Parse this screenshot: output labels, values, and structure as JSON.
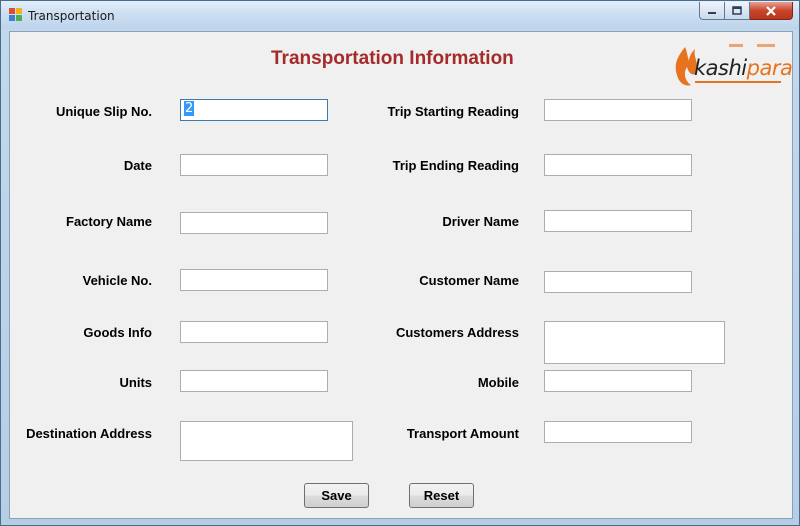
{
  "window": {
    "title": "Transportation",
    "colors": {
      "heading": "#a52a2a",
      "logo_accent": "#e8731e",
      "close": "#c9462c"
    }
  },
  "form": {
    "heading": "Transportation Information",
    "logo": {
      "prefix": "kashi",
      "accent": "para"
    },
    "left_fields": [
      {
        "label": "Unique Slip No.",
        "value": "2"
      },
      {
        "label": "Date",
        "value": ""
      },
      {
        "label": "Factory Name",
        "value": ""
      },
      {
        "label": "Vehicle No.",
        "value": ""
      },
      {
        "label": "Goods Info",
        "value": ""
      },
      {
        "label": "Units",
        "value": ""
      },
      {
        "label": "Destination Address",
        "value": ""
      }
    ],
    "right_fields": [
      {
        "label": "Trip Starting Reading",
        "value": ""
      },
      {
        "label": "Trip Ending Reading",
        "value": ""
      },
      {
        "label": "Driver Name",
        "value": ""
      },
      {
        "label": "Customer Name",
        "value": ""
      },
      {
        "label": "Customers Address",
        "value": ""
      },
      {
        "label": "Mobile",
        "value": ""
      },
      {
        "label": "Transport Amount",
        "value": ""
      }
    ],
    "buttons": {
      "save": "Save",
      "reset": "Reset"
    }
  }
}
